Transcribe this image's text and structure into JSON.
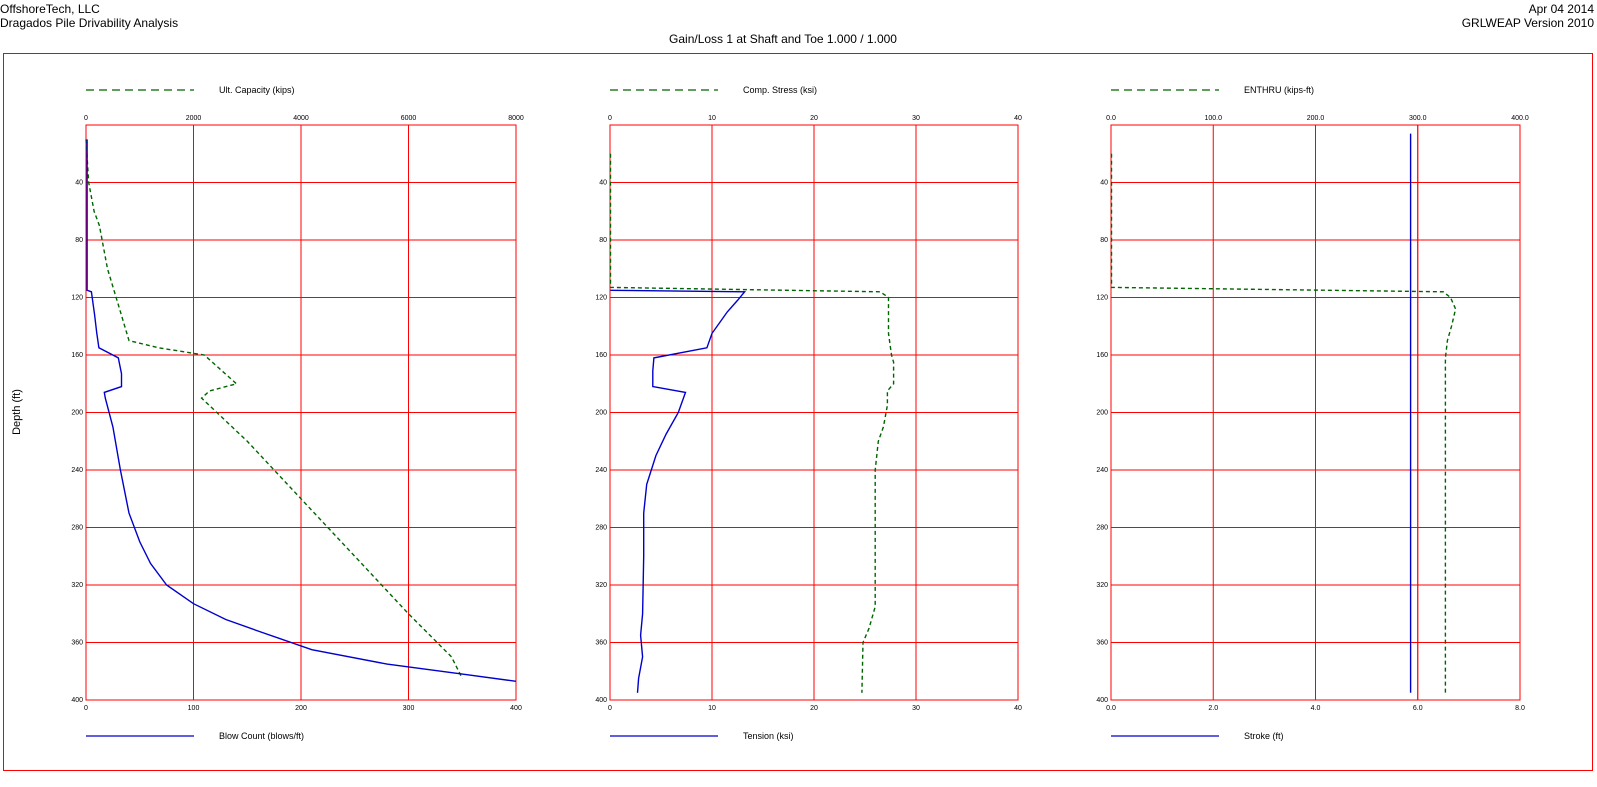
{
  "header": {
    "company": "OffshoreTech, LLC",
    "project": "Dragados Pile Drivability Analysis",
    "subtitle": "Gain/Loss 1 at Shaft and Toe 1.000 / 1.000",
    "date": "Apr 04 2014",
    "version": "GRLWEAP Version 2010"
  },
  "colors": {
    "grid": "#ff0000",
    "top_series": "#006400",
    "bottom_series": "#0000cc"
  },
  "chart_data": [
    {
      "type": "line",
      "ylabel": "Depth (ft)",
      "ylim": [
        400,
        0
      ],
      "yticks": [
        "40",
        "80",
        "120",
        "160",
        "200",
        "240",
        "280",
        "320",
        "360",
        "400"
      ],
      "grid": true,
      "top_axis": {
        "legend": "Ult. Capacity (kips)",
        "ticks": [
          "0",
          "2000",
          "4000",
          "6000",
          "8000"
        ],
        "range": [
          0,
          8000
        ],
        "series": {
          "name": "Ult. Capacity (kips)",
          "style": "dashed",
          "points": [
            [
              0,
              10
            ],
            [
              50,
              40
            ],
            [
              150,
              60
            ],
            [
              250,
              70
            ],
            [
              400,
              100
            ],
            [
              600,
              125
            ],
            [
              800,
              150
            ],
            [
              1350,
              155
            ],
            [
              2200,
              160
            ],
            [
              2800,
              180
            ],
            [
              2300,
              185
            ],
            [
              2150,
              190
            ],
            [
              3000,
              220
            ],
            [
              4000,
              260
            ],
            [
              5000,
              300
            ],
            [
              6000,
              340
            ],
            [
              6800,
              370
            ],
            [
              7000,
              385
            ]
          ]
        }
      },
      "bottom_axis": {
        "legend": "Blow Count (blows/ft)",
        "ticks": [
          "0",
          "100",
          "200",
          "300",
          "400"
        ],
        "range": [
          0,
          400
        ],
        "series": {
          "name": "Blow Count (blows/ft)",
          "style": "solid",
          "points": [
            [
              1,
              10
            ],
            [
              1,
              115
            ],
            [
              5,
              116
            ],
            [
              8,
              132
            ],
            [
              10,
              145
            ],
            [
              12,
              155
            ],
            [
              30,
              162
            ],
            [
              33,
              173
            ],
            [
              33,
              182
            ],
            [
              17,
              186
            ],
            [
              18,
              190
            ],
            [
              25,
              210
            ],
            [
              32,
              240
            ],
            [
              40,
              270
            ],
            [
              50,
              290
            ],
            [
              60,
              305
            ],
            [
              75,
              320
            ],
            [
              100,
              333
            ],
            [
              130,
              344
            ],
            [
              160,
              352
            ],
            [
              210,
              365
            ],
            [
              280,
              375
            ],
            [
              350,
              382
            ],
            [
              400,
              387
            ]
          ]
        }
      }
    },
    {
      "type": "line",
      "ylim": [
        400,
        0
      ],
      "yticks": [
        "40",
        "80",
        "120",
        "160",
        "200",
        "240",
        "280",
        "320",
        "360",
        "400"
      ],
      "grid": true,
      "top_axis": {
        "legend": "Comp. Stress (ksi)",
        "ticks": [
          "0",
          "10",
          "20",
          "30",
          "40"
        ],
        "range": [
          0,
          40
        ],
        "series": {
          "name": "Comp. Stress (ksi)",
          "style": "dashed",
          "points": [
            [
              0.05,
              20
            ],
            [
              0.05,
              60
            ],
            [
              0.05,
              113
            ],
            [
              26.5,
              116
            ],
            [
              27.3,
              120
            ],
            [
              27.3,
              145
            ],
            [
              27.6,
              160
            ],
            [
              27.8,
              165
            ],
            [
              27.8,
              180
            ],
            [
              27.2,
              185
            ],
            [
              27.2,
              195
            ],
            [
              26.8,
              210
            ],
            [
              26.3,
              220
            ],
            [
              26.0,
              240
            ],
            [
              26.0,
              300
            ],
            [
              26.0,
              335
            ],
            [
              25.4,
              350
            ],
            [
              24.8,
              360
            ],
            [
              24.7,
              395
            ]
          ]
        }
      },
      "bottom_axis": {
        "legend": "Tension (ksi)",
        "ticks": [
          "0",
          "10",
          "20",
          "30",
          "40"
        ],
        "range": [
          0,
          40
        ],
        "series": {
          "name": "Tension (ksi)",
          "style": "solid",
          "points": [
            [
              0.05,
              115
            ],
            [
              13.2,
              116
            ],
            [
              12.5,
              122
            ],
            [
              11.5,
              130
            ],
            [
              10,
              145
            ],
            [
              9.5,
              155
            ],
            [
              4.3,
              162
            ],
            [
              4.2,
              171
            ],
            [
              4.2,
              182
            ],
            [
              7.4,
              186
            ],
            [
              6.7,
              200
            ],
            [
              5.5,
              215
            ],
            [
              4.5,
              230
            ],
            [
              3.6,
              250
            ],
            [
              3.3,
              270
            ],
            [
              3.3,
              300
            ],
            [
              3.2,
              340
            ],
            [
              3.0,
              355
            ],
            [
              3.2,
              370
            ],
            [
              2.8,
              385
            ],
            [
              2.7,
              395
            ]
          ]
        }
      }
    },
    {
      "type": "line",
      "ylim": [
        400,
        0
      ],
      "yticks": [
        "40",
        "80",
        "120",
        "160",
        "200",
        "240",
        "280",
        "320",
        "360",
        "400"
      ],
      "grid": true,
      "top_axis": {
        "legend": "ENTHRU (kips-ft)",
        "ticks": [
          "0.0",
          "100.0",
          "200.0",
          "300.0",
          "400.0"
        ],
        "range": [
          0,
          400
        ],
        "series": {
          "name": "ENTHRU (kips-ft)",
          "style": "dashed",
          "points": [
            [
              0.5,
              20
            ],
            [
              0.5,
              113
            ],
            [
              325,
              116
            ],
            [
              332,
              120
            ],
            [
              337,
              128
            ],
            [
              333,
              140
            ],
            [
              329,
              150
            ],
            [
              327,
              162
            ],
            [
              327,
              395
            ]
          ]
        }
      },
      "bottom_axis": {
        "legend": "Stroke (ft)",
        "ticks": [
          "0.0",
          "2.0",
          "4.0",
          "6.0",
          "8.0"
        ],
        "range": [
          0,
          8
        ],
        "vline_at": 6.0,
        "series": {
          "name": "Stroke (ft)",
          "style": "solid",
          "points": [
            [
              5.86,
              6
            ],
            [
              5.86,
              395
            ]
          ]
        }
      }
    }
  ]
}
